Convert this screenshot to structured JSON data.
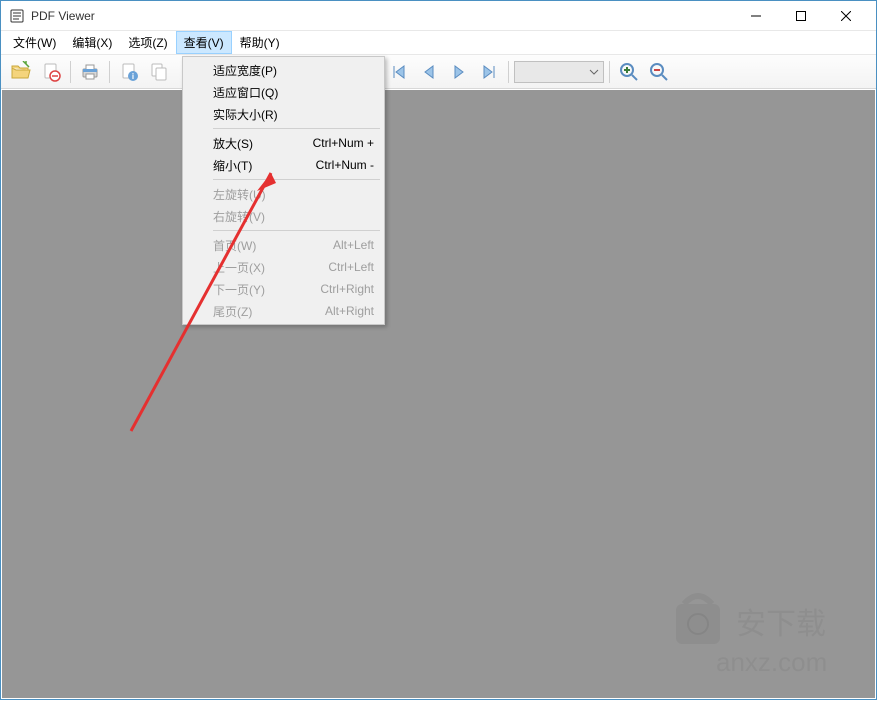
{
  "titlebar": {
    "title": "PDF Viewer"
  },
  "menubar": {
    "items": [
      {
        "label": "文件(W)"
      },
      {
        "label": "编辑(X)"
      },
      {
        "label": "选项(Z)"
      },
      {
        "label": "查看(V)"
      },
      {
        "label": "帮助(Y)"
      }
    ],
    "active_index": 3
  },
  "dropdown": {
    "groups": [
      [
        {
          "label": "适应宽度(P)",
          "shortcut": "",
          "disabled": false
        },
        {
          "label": "适应窗口(Q)",
          "shortcut": "",
          "disabled": false
        },
        {
          "label": "实际大小(R)",
          "shortcut": "",
          "disabled": false
        }
      ],
      [
        {
          "label": "放大(S)",
          "shortcut": "Ctrl+Num +",
          "disabled": false
        },
        {
          "label": "缩小(T)",
          "shortcut": "Ctrl+Num -",
          "disabled": false
        }
      ],
      [
        {
          "label": "左旋转(U)",
          "shortcut": "",
          "disabled": true
        },
        {
          "label": "右旋转(V)",
          "shortcut": "",
          "disabled": true
        }
      ],
      [
        {
          "label": "首页(W)",
          "shortcut": "Alt+Left",
          "disabled": true
        },
        {
          "label": "上一页(X)",
          "shortcut": "Ctrl+Left",
          "disabled": true
        },
        {
          "label": "下一页(Y)",
          "shortcut": "Ctrl+Right",
          "disabled": true
        },
        {
          "label": "尾页(Z)",
          "shortcut": "Alt+Right",
          "disabled": true
        }
      ]
    ]
  },
  "watermark": {
    "text_main": "安下载",
    "text_sub": "anxz.com"
  }
}
